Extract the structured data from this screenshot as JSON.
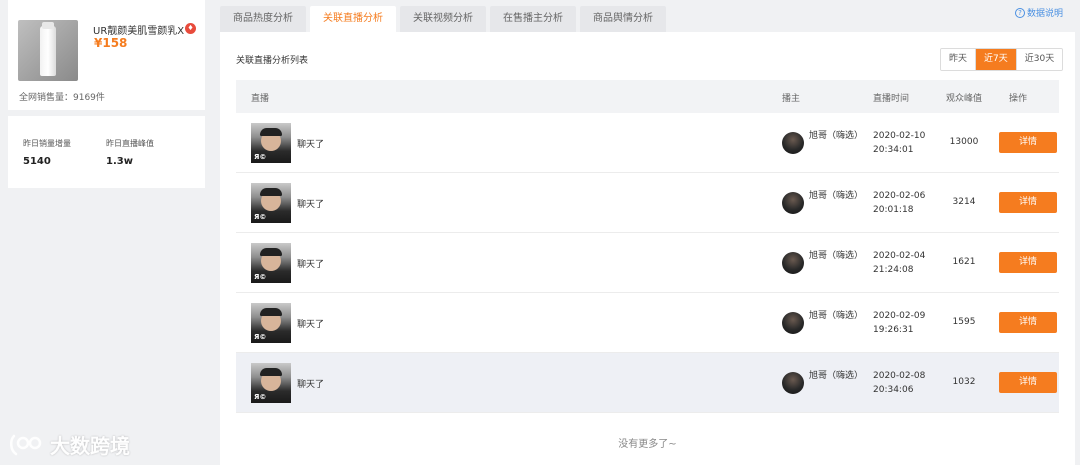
{
  "product": {
    "name": "UR靓颜美肌雪颜乳X",
    "price": "¥158",
    "total_sales": "全网销售量：9169件",
    "stats": [
      {
        "label": "昨日销量增量",
        "value": "5140"
      },
      {
        "label": "昨日直播峰值",
        "value": "1.3w"
      }
    ]
  },
  "tabs": [
    "商品热度分析",
    "关联直播分析",
    "关联视频分析",
    "在售播主分析",
    "商品舆情分析"
  ],
  "active_tab": 1,
  "help_link": "数据说明",
  "panel": {
    "title": "关联直播分析列表",
    "ranges": [
      "昨天",
      "近7天",
      "近30天"
    ],
    "active_range": 1
  },
  "table": {
    "headers": {
      "live": "直播",
      "host": "播主",
      "time": "直播时间",
      "viewers": "观众峰值",
      "action": "操作"
    },
    "rows": [
      {
        "title": "聊天了",
        "host": "旭哥（嗨选）",
        "date": "2020-02-10",
        "clock": "20:34:01",
        "viewers": "13000",
        "action": "详情"
      },
      {
        "title": "聊天了",
        "host": "旭哥（嗨选）",
        "date": "2020-02-06",
        "clock": "20:01:18",
        "viewers": "3214",
        "action": "详情"
      },
      {
        "title": "聊天了",
        "host": "旭哥（嗨选）",
        "date": "2020-02-04",
        "clock": "21:24:08",
        "viewers": "1621",
        "action": "详情"
      },
      {
        "title": "聊天了",
        "host": "旭哥（嗨选）",
        "date": "2020-02-09",
        "clock": "19:26:31",
        "viewers": "1595",
        "action": "详情"
      },
      {
        "title": "聊天了",
        "host": "旭哥（嗨选）",
        "date": "2020-02-08",
        "clock": "20:34:06",
        "viewers": "1032",
        "action": "详情"
      }
    ],
    "no_more": "没有更多了~"
  },
  "watermark": "大数跨境",
  "colors": {
    "accent": "#f57c1f",
    "link": "#4a90e2",
    "hot": "#e84b3c"
  }
}
